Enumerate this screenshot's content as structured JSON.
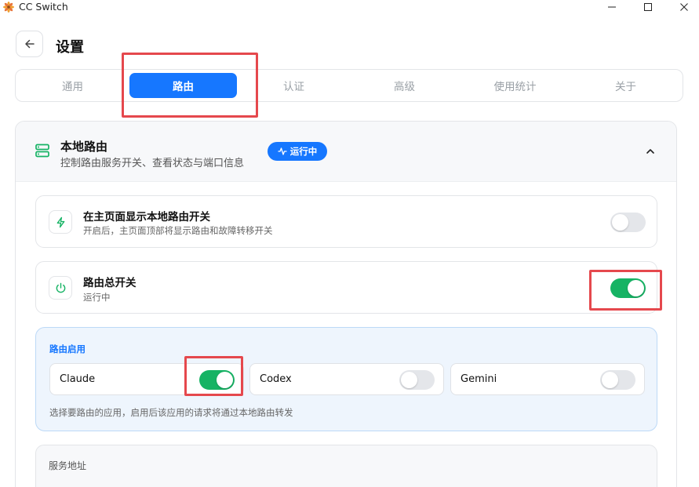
{
  "window": {
    "title": "CC Switch",
    "logo_icon": "flower-logo-icon"
  },
  "header": {
    "title": "设置",
    "back_icon": "arrow-left-icon"
  },
  "tabs": [
    {
      "label": "通用",
      "active": false
    },
    {
      "label": "路由",
      "active": true
    },
    {
      "label": "认证",
      "active": false
    },
    {
      "label": "高级",
      "active": false
    },
    {
      "label": "使用统计",
      "active": false
    },
    {
      "label": "关于",
      "active": false
    }
  ],
  "local_routing": {
    "title": "本地路由",
    "subtitle": "控制路由服务开关、查看状态与端口信息",
    "status_badge": "运行中",
    "expanded": true
  },
  "show_switch_card": {
    "title": "在主页面显示本地路由开关",
    "subtitle": "开启后，主页面顶部将显示路由和故障转移开关",
    "enabled": false,
    "icon": "lightning-icon"
  },
  "master_switch_card": {
    "title": "路由总开关",
    "subtitle": "运行中",
    "enabled": true,
    "icon": "power-icon"
  },
  "routing_enable": {
    "label": "路由启用",
    "apps": [
      {
        "name": "Claude",
        "enabled": true
      },
      {
        "name": "Codex",
        "enabled": false
      },
      {
        "name": "Gemini",
        "enabled": false
      }
    ],
    "hint": "选择要路由的应用，启用后该应用的请求将通过本地路由转发"
  },
  "service_address": {
    "label": "服务地址"
  },
  "colors": {
    "accent": "#1677ff",
    "toggle_on": "#16b364",
    "highlight_box": "#e5484d"
  }
}
